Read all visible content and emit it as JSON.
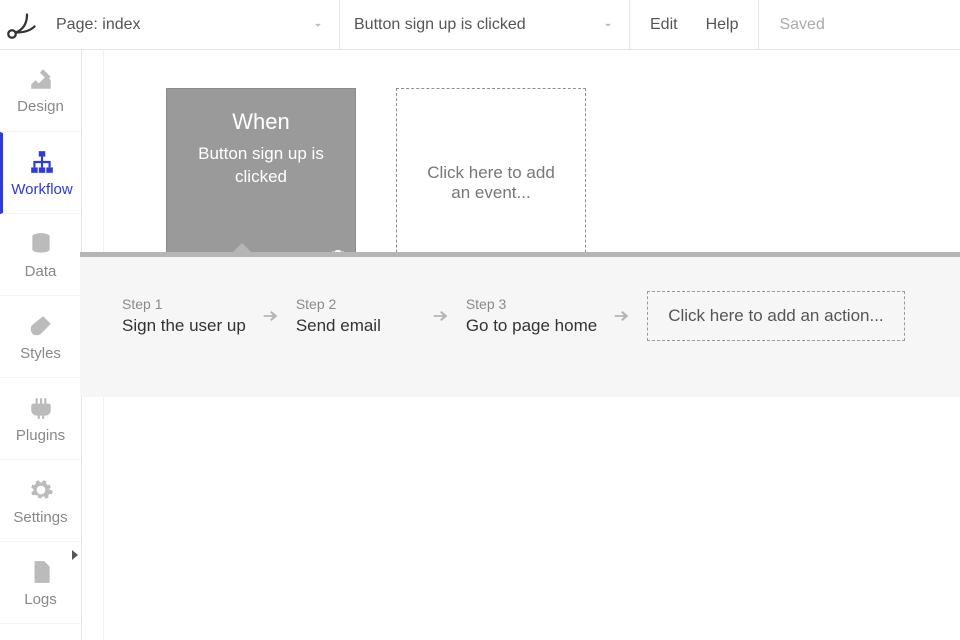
{
  "topbar": {
    "page_label": "Page: index",
    "event_label": "Button sign up is clicked",
    "edit": "Edit",
    "help": "Help",
    "saved": "Saved"
  },
  "sidebar": {
    "items": [
      {
        "label": "Design"
      },
      {
        "label": "Workflow"
      },
      {
        "label": "Data"
      },
      {
        "label": "Styles"
      },
      {
        "label": "Plugins"
      },
      {
        "label": "Settings"
      },
      {
        "label": "Logs"
      }
    ],
    "active_index": 1
  },
  "workflow": {
    "event": {
      "when": "When",
      "desc": "Button sign up is clicked"
    },
    "add_event": "Click here to add an event...",
    "steps": [
      {
        "label": "Step 1",
        "text": "Sign the user up"
      },
      {
        "label": "Step 2",
        "text": "Send email"
      },
      {
        "label": "Step 3",
        "text": "Go to page home"
      }
    ],
    "add_action": "Click here to add an action..."
  }
}
